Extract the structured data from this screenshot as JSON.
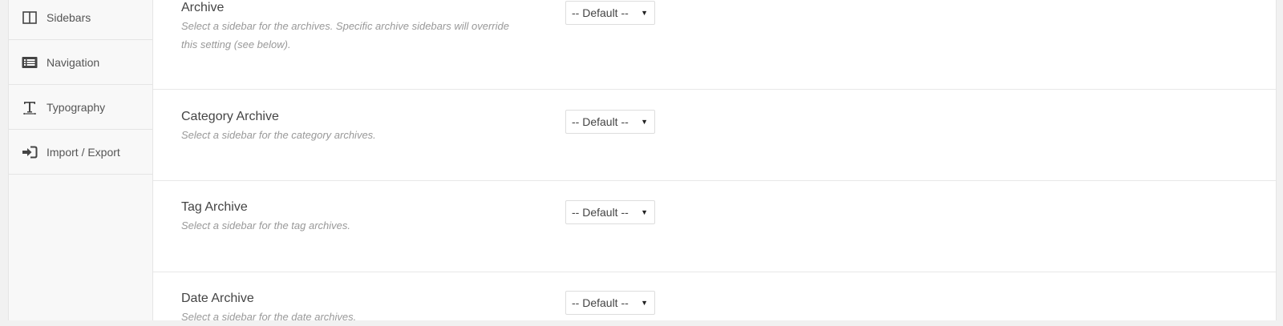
{
  "sidebar": {
    "items": [
      {
        "label": "Sidebars",
        "icon": "columns-icon"
      },
      {
        "label": "Navigation",
        "icon": "list-icon"
      },
      {
        "label": "Typography",
        "icon": "text-icon"
      },
      {
        "label": "Import / Export",
        "icon": "sign-in-icon"
      }
    ]
  },
  "sections": [
    {
      "title": "Archive",
      "description": "Select a sidebar for the archives. Specific archive sidebars will override this setting (see below).",
      "select_value": "-- Default --"
    },
    {
      "title": "Category Archive",
      "description": "Select a sidebar for the category archives.",
      "select_value": "-- Default --"
    },
    {
      "title": "Tag Archive",
      "description": "Select a sidebar for the tag archives.",
      "select_value": "-- Default --"
    },
    {
      "title": "Date Archive",
      "description": "Select a sidebar for the date archives.",
      "select_value": "-- Default --"
    }
  ],
  "colors": {
    "text": "#555555",
    "muted": "#999999",
    "border": "#e5e5e5"
  }
}
